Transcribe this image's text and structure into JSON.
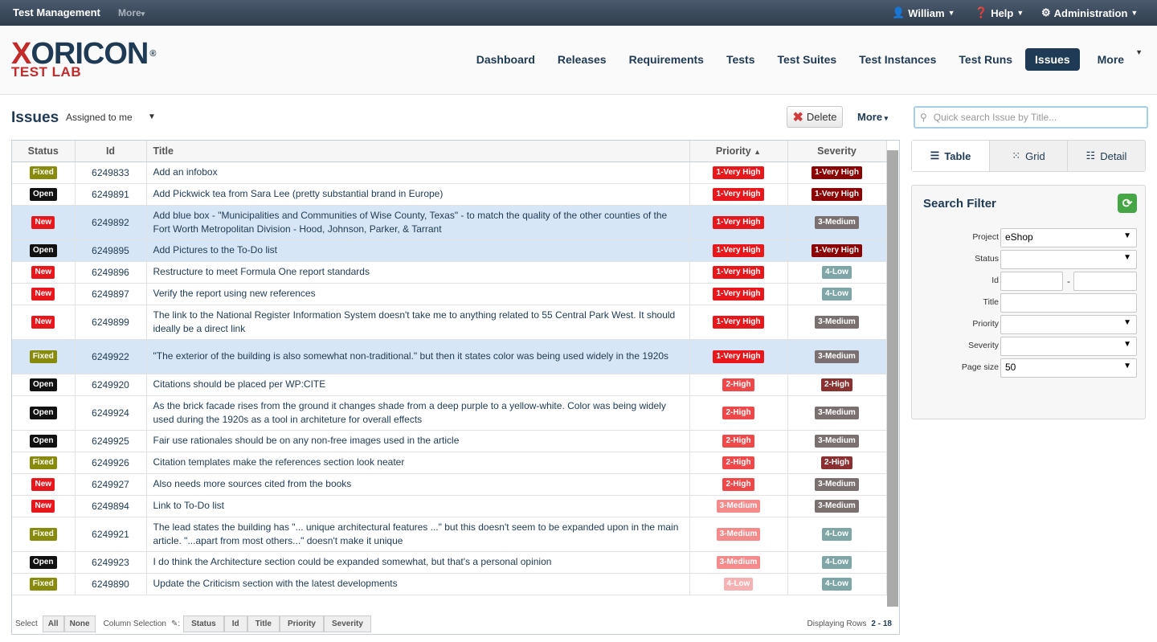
{
  "topbar": {
    "app": "Test Management",
    "more": "More",
    "user": "William",
    "help": "Help",
    "admin": "Administration"
  },
  "logo": {
    "line1a": "X",
    "line1b": "ORICON",
    "reg": "®",
    "line2": "TEST LAB"
  },
  "nav": [
    "Dashboard",
    "Releases",
    "Requirements",
    "Tests",
    "Test Suites",
    "Test Instances",
    "Test Runs",
    "Issues",
    "More"
  ],
  "page": {
    "title": "Issues",
    "assigned": "Assigned to me",
    "delete": "Delete",
    "more": "More"
  },
  "columns": [
    "Status",
    "Id",
    "Title",
    "Priority",
    "Severity"
  ],
  "colors": {
    "fixed": "#888a0a",
    "open": "#111111",
    "new": "#e8171b",
    "p1": "#e8171b",
    "p2": "#f04848",
    "p3": "#f48a8a",
    "p4": "#f6b2b2",
    "sv1": "#8b0000",
    "sv2": "#8b3030",
    "sv3": "#7a7070",
    "sv4": "#7fa6a6"
  },
  "rows": [
    {
      "status": "Fixed",
      "id": "6249833",
      "title": "Add an infobox",
      "priority": "1-Very High",
      "severity": "1-Very High",
      "sel": false
    },
    {
      "status": "Open",
      "id": "6249891",
      "title": "Add Pickwick tea from Sara Lee (pretty substantial brand in Europe)",
      "priority": "1-Very High",
      "severity": "1-Very High",
      "sel": false
    },
    {
      "status": "New",
      "id": "6249892",
      "title": "Add blue box - \"Municipalities and Communities of Wise County, Texas\" - to match the quality of the other counties of the Fort Worth Metropolitan Division - Hood, Johnson, Parker, & Tarrant",
      "priority": "1-Very High",
      "severity": "3-Medium",
      "sel": true
    },
    {
      "status": "Open",
      "id": "6249895",
      "title": "Add Pictures to the To-Do list",
      "priority": "1-Very High",
      "severity": "1-Very High",
      "sel": true
    },
    {
      "status": "New",
      "id": "6249896",
      "title": "Restructure to meet Formula One report standards",
      "priority": "1-Very High",
      "severity": "4-Low",
      "sel": false
    },
    {
      "status": "New",
      "id": "6249897",
      "title": "Verify the report using new references",
      "priority": "1-Very High",
      "severity": "4-Low",
      "sel": false
    },
    {
      "status": "New",
      "id": "6249899",
      "title": "The link to the National Register Information System doesn't take me to anything related to 55 Central Park West. It should ideally be a direct link",
      "priority": "1-Very High",
      "severity": "3-Medium",
      "sel": false
    },
    {
      "status": "Fixed",
      "id": "6249922",
      "title": "\"The exterior of the building is also somewhat non-traditional.\" but then it states color was being used widely in the 1920s",
      "priority": "1-Very High",
      "severity": "3-Medium",
      "sel": true
    },
    {
      "status": "Open",
      "id": "6249920",
      "title": "Citations should be placed per WP:CITE",
      "priority": "2-High",
      "severity": "2-High",
      "sel": false
    },
    {
      "status": "Open",
      "id": "6249924",
      "title": "As the brick facade rises from the ground it changes shade from a deep purple to a yellow-white. Color was being widely used during the 1920s as a tool in architeture for overall effects",
      "priority": "2-High",
      "severity": "3-Medium",
      "sel": false
    },
    {
      "status": "Open",
      "id": "6249925",
      "title": "Fair use rationales should be on any non-free images used in the article",
      "priority": "2-High",
      "severity": "3-Medium",
      "sel": false
    },
    {
      "status": "Fixed",
      "id": "6249926",
      "title": "Citation templates make the references section look neater",
      "priority": "2-High",
      "severity": "2-High",
      "sel": false
    },
    {
      "status": "New",
      "id": "6249927",
      "title": "Also needs more sources cited from the books",
      "priority": "2-High",
      "severity": "3-Medium",
      "sel": false
    },
    {
      "status": "New",
      "id": "6249894",
      "title": "Link to To-Do list",
      "priority": "3-Medium",
      "severity": "3-Medium",
      "sel": false
    },
    {
      "status": "Fixed",
      "id": "6249921",
      "title": "The lead states the building has \"... unique architectural features ...\" but this doesn't seem to be expanded upon in the main article. \"...apart from most others...\" doesn't make it unique",
      "priority": "3-Medium",
      "severity": "4-Low",
      "sel": false
    },
    {
      "status": "Open",
      "id": "6249923",
      "title": "I do think the Architecture section could be expanded somewhat, but that's a personal opinion",
      "priority": "3-Medium",
      "severity": "4-Low",
      "sel": false
    },
    {
      "status": "Fixed",
      "id": "6249890",
      "title": "Update the Criticism section with the latest developments",
      "priority": "4-Low",
      "severity": "4-Low",
      "sel": false
    }
  ],
  "footer": {
    "select": "Select",
    "all": "All",
    "none": "None",
    "colsel": "Column Selection",
    "cols": [
      "Status",
      "Id",
      "Title",
      "Priority",
      "Severity"
    ],
    "displaying": "Displaying Rows",
    "range": "2 - 18"
  },
  "right": {
    "search_placeholder": "Quick search Issue by Title...",
    "views": [
      "Table",
      "Grid",
      "Detail"
    ],
    "filter_title": "Search Filter",
    "labels": [
      "Project",
      "Status",
      "Id",
      "Title",
      "Priority",
      "Severity",
      "Page size"
    ],
    "project": "eShop",
    "id_sep": "-",
    "page_size": "50"
  }
}
